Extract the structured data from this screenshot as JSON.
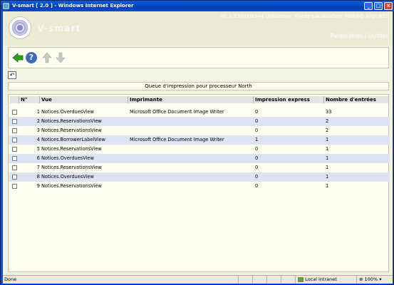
{
  "window": {
    "title": "V-smart [ 2.0 ] - Windows Internet Explorer"
  },
  "header": {
    "brand": "V-smart",
    "user_info": "Id: 1.23003/6344   Utilisateur: Tineke   Localisation: PNB/BD   AFO: 621",
    "links": [
      "Paramètres",
      "Quitter"
    ],
    "link_separator": "|"
  },
  "toolbar": {
    "help_label": "?"
  },
  "undo_label": "↶",
  "panel_title": "Queue d'impression pour processeur North",
  "table": {
    "headers": [
      "N°",
      "Vue",
      "Imprimante",
      "Impression express",
      "Nombre d'entrées"
    ],
    "rows": [
      {
        "n": "1",
        "vue": "Notices.OverduesView",
        "imprimante": "Microsoft Office Document Image Writer",
        "express": "0",
        "entrees": "33"
      },
      {
        "n": "2",
        "vue": "Notices.ReservationsView",
        "imprimante": "",
        "express": "0",
        "entrees": "2"
      },
      {
        "n": "3",
        "vue": "Notices.ReservationsView",
        "imprimante": "",
        "express": "0",
        "entrees": "2"
      },
      {
        "n": "4",
        "vue": "Notices.BorrowerLabelView",
        "imprimante": "Microsoft Office Document Image Writer",
        "express": "1",
        "entrees": "1"
      },
      {
        "n": "5",
        "vue": "Notices.ReservationsView",
        "imprimante": "",
        "express": "0",
        "entrees": "1"
      },
      {
        "n": "6",
        "vue": "Notices.OverduesView",
        "imprimante": "",
        "express": "0",
        "entrees": "1"
      },
      {
        "n": "7",
        "vue": "Notices.ReservationsView",
        "imprimante": "",
        "express": "0",
        "entrees": "1"
      },
      {
        "n": "8",
        "vue": "Notices.OverduesView",
        "imprimante": "",
        "express": "0",
        "entrees": "1"
      },
      {
        "n": "9",
        "vue": "Notices.ReservationsView",
        "imprimante": "",
        "express": "0",
        "entrees": "1"
      }
    ]
  },
  "statusbar": {
    "status": "Done",
    "zone": "Local intranet",
    "zoom": "100%"
  },
  "colors": {
    "accent": "#0054e3",
    "row_alt": "#dce4f2"
  }
}
